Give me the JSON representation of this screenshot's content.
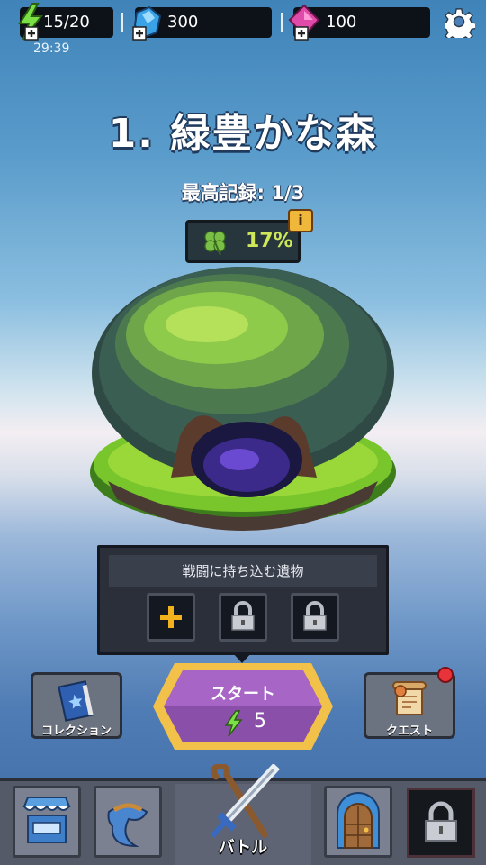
{
  "resources": {
    "energy": {
      "value": "15/20",
      "icon": "lightning-icon",
      "color": "#7be046"
    },
    "energy_timer": "29:39",
    "gems": {
      "value": "300",
      "icon": "blue-crystal-icon",
      "color": "#3aa3e8"
    },
    "rubies": {
      "value": "100",
      "icon": "pink-gem-icon",
      "color": "#e04aa8"
    }
  },
  "stage": {
    "title": "1. 緑豊かな森",
    "best_record": "最高記録: 1/3",
    "luck_percent": "17%",
    "luck_icon": "clover-icon",
    "info_badge": "i"
  },
  "relics": {
    "header": "戦闘に持ち込む遺物",
    "slots": [
      {
        "state": "add",
        "icon": "plus-icon"
      },
      {
        "state": "locked",
        "icon": "lock-icon"
      },
      {
        "state": "locked",
        "icon": "lock-icon"
      }
    ]
  },
  "start_button": {
    "label": "スタート",
    "cost": "5",
    "cost_icon": "lightning-icon"
  },
  "side_buttons": {
    "collection": {
      "label": "コレクション",
      "icon": "book-icon"
    },
    "quest": {
      "label": "クエスト",
      "icon": "scroll-icon",
      "has_notification": true
    }
  },
  "bottom_nav": {
    "items": [
      {
        "name": "shop",
        "icon": "shop-icon"
      },
      {
        "name": "equipment",
        "icon": "scarf-icon"
      },
      {
        "name": "battle",
        "label": "バトル",
        "icon": "sword-staff-icon"
      },
      {
        "name": "dungeon-door",
        "icon": "door-icon"
      },
      {
        "name": "locked",
        "icon": "lock-icon"
      }
    ]
  },
  "colors": {
    "accent_gold": "#f2c14a",
    "start_purple": "#a765c6",
    "luck_green": "#cfe85a"
  }
}
